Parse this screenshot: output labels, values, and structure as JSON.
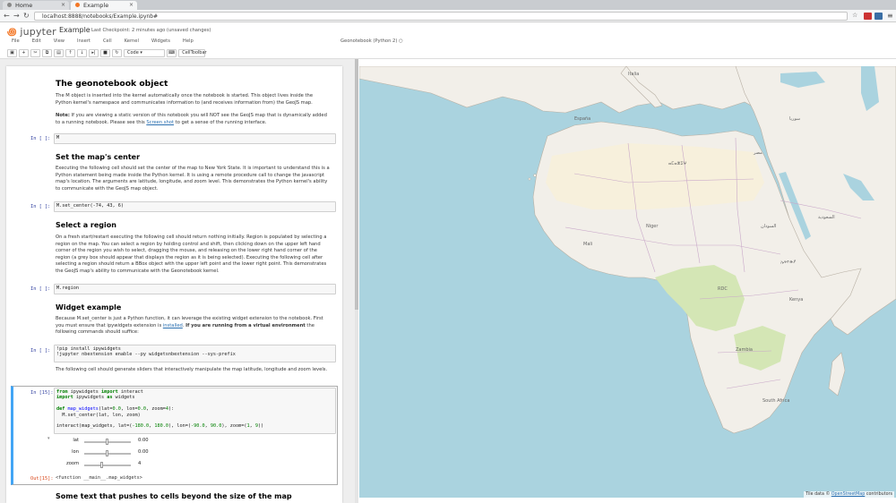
{
  "browser": {
    "tabs": [
      {
        "label": "Home"
      },
      {
        "label": "Example"
      }
    ],
    "url": "localhost:8888/notebooks/Example.ipynb#"
  },
  "header": {
    "logo": "jupyter",
    "title": "Example",
    "checkpoint": "Last Checkpoint: 2 minutes ago (unsaved changes)",
    "kernel": "Geonotebook (Python 2)"
  },
  "menu": [
    "File",
    "Edit",
    "View",
    "Insert",
    "Cell",
    "Kernel",
    "Widgets",
    "Help"
  ],
  "toolbar": {
    "cell_type": "Code",
    "cell_toolbar": "CellToolbar"
  },
  "notebook": {
    "h1": "The geonotebook object",
    "p1": "The M object is inserted into the kernel automatically once the notebook is started. This object lives inside the Python kernel's namespace and communicates information to (and receives information from) the GeoJS map.",
    "note_bold": "Note:",
    "note_text": "If you are viewing a static version of this notebook you will NOT see the GeoJS map that is dynamically added to a running notebook. Please see this",
    "note_link": "Screen shot",
    "note_end": "to get a sense of the running interface.",
    "cell1": {
      "prompt": "In [ ]:",
      "code": "M"
    },
    "h2": "Set the map's center",
    "p2": "Executing the following cell should set the center of the map to New York State. It is important to understand this is a Python statement being made inside the Python kernel. It is using a remote procedure call to change the javascript map's location. The arguments are latitude, longitude, and zoom level. This demonstrates the Python kernel's ability to communicate with the GeoJS map object.",
    "cell2": {
      "prompt": "In [ ]:",
      "code": "M.set_center(-74, 43, 6)"
    },
    "h3": "Select a region",
    "p3": "On a fresh start/restart executing the following cell should return nothing initially. Region is populated by selecting a region on the map. You can select a region by holding control and shift, then clicking down on the upper left hand corner of the region you wish to select, dragging the mouse, and releasing on the lower right hand corner of the region (a grey box should appear that displays the region as it is being selected). Executing the following cell after selecting a region should return a BBox object with the upper left point and the lower right point. This demonstrates the GeoJS map's ability to communicate with the Geonotebook kernel.",
    "cell3": {
      "prompt": "In [ ]:",
      "code": "M.region"
    },
    "h4": "Widget example",
    "p4a": "Because M.set_center is just a Python function, it can leverage the existing widget extension to the notebook. First you must ensure that ipywidgets extension is",
    "p4link": "installed",
    "p4b": "If you are running from a virtual environment",
    "p4c": "the following commands should suffice:",
    "cell4": {
      "prompt": "In [ ]:",
      "code": "!pip install ipywidgets\n!jupyter nbextension enable --py widgetsnbextension --sys-prefix"
    },
    "p5": "The following cell should generate sliders that interactively manipulate the map latitude, longitude and zoom levels.",
    "cell5": {
      "prompt": "In [15]:",
      "code": "from ipywidgets import interact\nimport ipywidgets as widgets\n\ndef map_widgets(lat=0.0, lon=0.0, zoom=4):\n  M.set_center(lat, lon, zoom)\n\ninteract(map_widgets, lat=(-180.0, 180.0), lon=(-90.0, 90.0), zoom=(1, 9))"
    },
    "sliders": [
      {
        "label": "lat",
        "value": "0.00",
        "fraction": 0.5
      },
      {
        "label": "lon",
        "value": "0.00",
        "fraction": 0.5
      },
      {
        "label": "zoom",
        "value": "4",
        "fraction": 0.375
      }
    ],
    "out_prompt": "Out[15]:",
    "out_text": "<function __main__.map_widgets>",
    "h5": "Some text that pushes to cells beyond the size of the map"
  },
  "map": {
    "attribution_prefix": "Tile data ©",
    "attribution_link": "OpenStreetMap",
    "attribution_suffix": "contributors"
  },
  "colors": {
    "sea": "#aad3df",
    "land": "#f2efe9",
    "green": "#d4e6b5",
    "desert": "#f7f0dc",
    "accent": "#42a5f5"
  }
}
